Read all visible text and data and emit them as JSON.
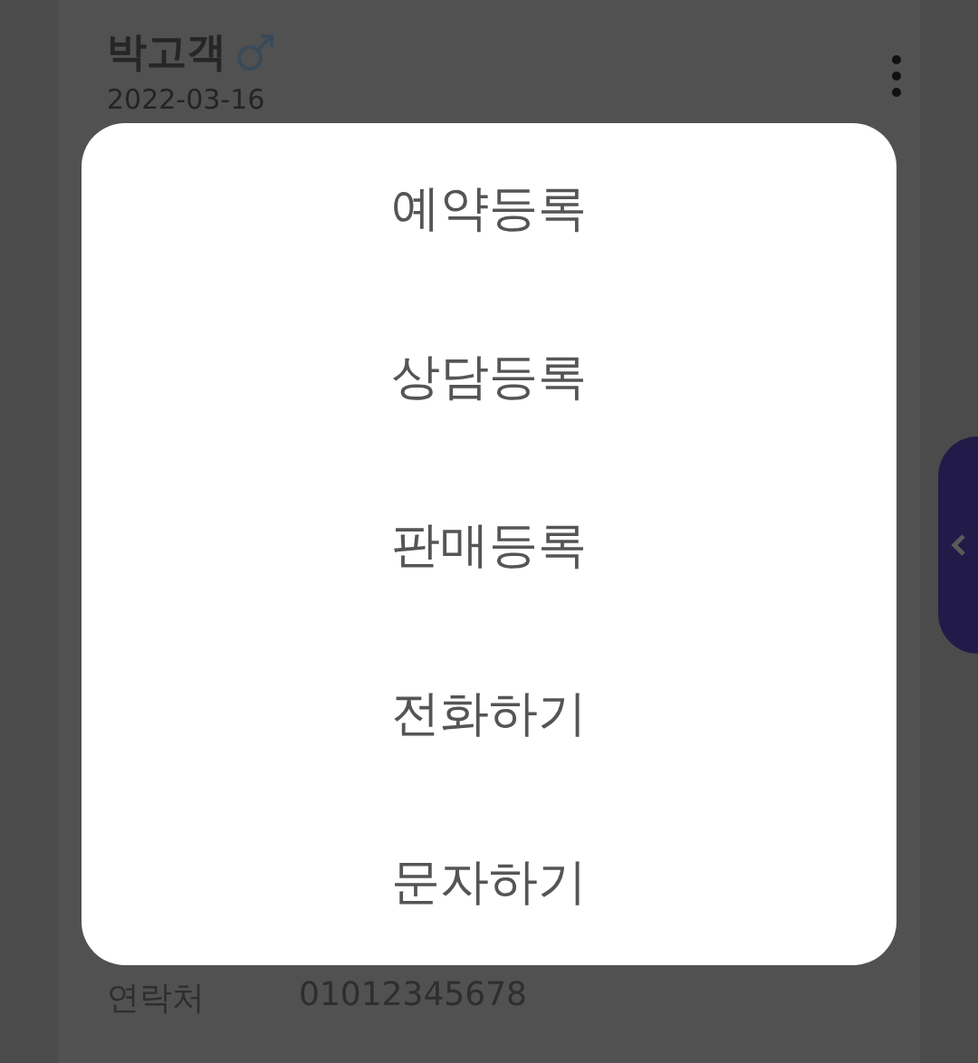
{
  "customer": {
    "name": "박고객",
    "date": "2022-03-16"
  },
  "contact": {
    "label": "연락처",
    "value": "01012345678"
  },
  "action_menu": {
    "items": [
      {
        "label": "예약등록"
      },
      {
        "label": "상담등록"
      },
      {
        "label": "판매등록"
      },
      {
        "label": "전화하기"
      },
      {
        "label": "문자하기"
      }
    ]
  }
}
